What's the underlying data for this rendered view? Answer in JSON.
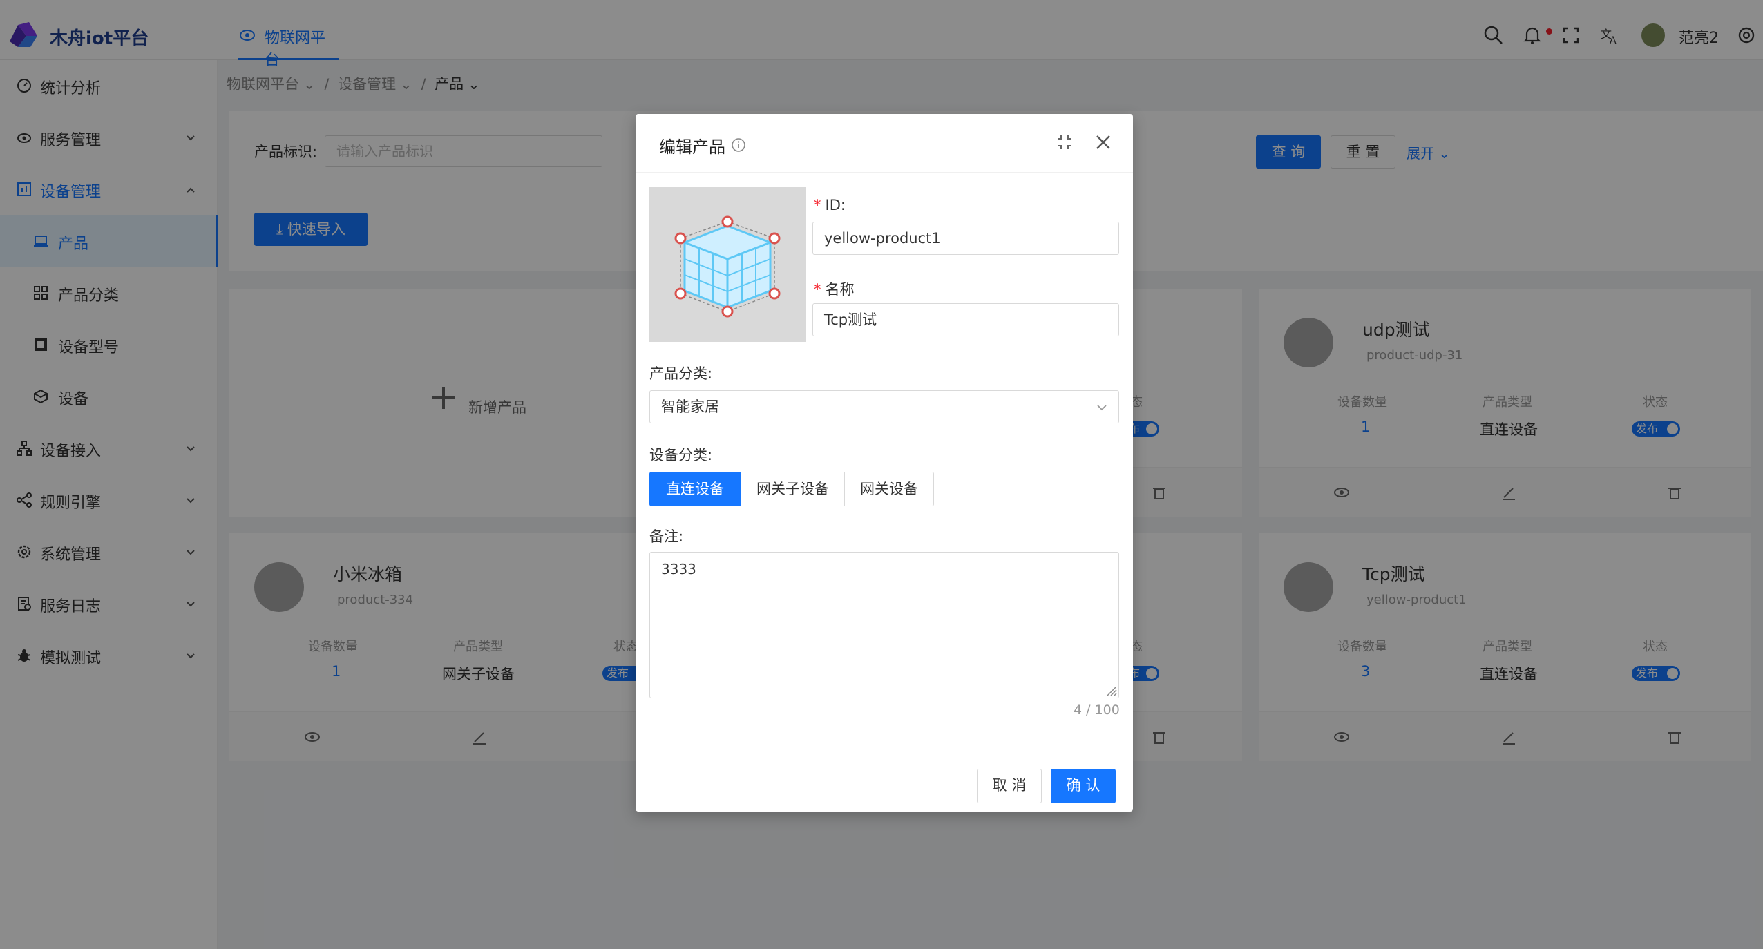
{
  "header": {
    "brand": "木舟iot平台",
    "nav_tab": "物联网平台",
    "username": "范亮2",
    "icons": [
      "search-icon",
      "bell-icon",
      "fullscreen-icon",
      "translate-icon",
      "avatar",
      "settings-icon"
    ]
  },
  "sidebar": {
    "items": [
      {
        "label": "统计分析",
        "icon": "dashboard-icon"
      },
      {
        "label": "服务管理",
        "icon": "cloud-icon"
      },
      {
        "label": "设备管理",
        "icon": "chart-icon"
      },
      {
        "label": "产品",
        "icon": "laptop-icon"
      },
      {
        "label": "产品分类",
        "icon": "grid-icon"
      },
      {
        "label": "设备型号",
        "icon": "chip-icon"
      },
      {
        "label": "设备",
        "icon": "box-icon"
      },
      {
        "label": "设备接入",
        "icon": "network-icon"
      },
      {
        "label": "规则引擎",
        "icon": "share-icon"
      },
      {
        "label": "系统管理",
        "icon": "gear-icon"
      },
      {
        "label": "服务日志",
        "icon": "log-icon"
      },
      {
        "label": "模拟测试",
        "icon": "bug-icon"
      }
    ]
  },
  "breadcrumb": {
    "b1": "物联网平台",
    "b2": "设备管理",
    "b3": "产品",
    "sep": "/"
  },
  "search": {
    "label": "产品标识:",
    "placeholder": "请输入产品标识",
    "query_btn": "查 询",
    "reset_btn": "重 置",
    "expand": "展开"
  },
  "import_btn": "快速导入",
  "add_product": "新增产品",
  "stats_labels": {
    "count": "设备数量",
    "type": "产品类型",
    "status": "状态"
  },
  "cards": [
    {
      "name": "udp测试",
      "id": "product-udp-31",
      "count": "1",
      "type": "直连设备",
      "status": "发布"
    },
    {
      "name": "小米冰箱",
      "id": "product-334",
      "count": "1",
      "type": "网关子设备",
      "status": "发布"
    },
    {
      "name": "Tcp测试",
      "id": "yellow-product1",
      "count": "3",
      "type": "直连设备",
      "status": "发布"
    }
  ],
  "partial": {
    "status_label": "态",
    "status_toggle": "布"
  },
  "modal": {
    "title": "编辑产品",
    "id_label": "ID:",
    "id_value": "yellow-product1",
    "name_label": "名称",
    "name_value": "Tcp测试",
    "category_label": "产品分类:",
    "category_value": "智能家居",
    "device_type_label": "设备分类:",
    "device_types": [
      "直连设备",
      "网关子设备",
      "网关设备"
    ],
    "selected_device_type": "直连设备",
    "remark_label": "备注:",
    "remark_value": "3333",
    "counter": "4 / 100",
    "cancel": "取 消",
    "ok": "确 认"
  },
  "colors": {
    "primary": "#1677ff",
    "brand": "#1f3f8f",
    "required": "#f5222d"
  }
}
